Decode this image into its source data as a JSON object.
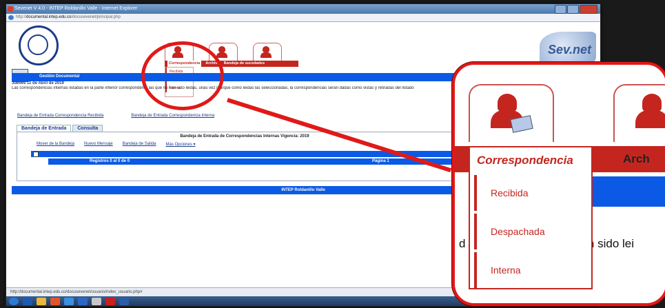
{
  "window": {
    "title": "Sevenet V 4.0 - INTEP Roldanillo Valle - Internet Explorer"
  },
  "address": {
    "prefix": "http://",
    "domain": "documental.intep.edu.co",
    "path": "/docusevenet/principal.php"
  },
  "nav": {
    "tabs": [
      "Correspondencia",
      "Archivo",
      "Bandeja de sucedades"
    ],
    "active_tab": "Correspondencia",
    "dropdown_items": [
      "Recibida",
      "Despachada",
      "Interna"
    ]
  },
  "module": {
    "title": "Gestión Documental"
  },
  "date": "Jueves 11 de Abril de 2019",
  "info_text": "Las correspondencias internas listadas en la parte inferior corresponden a las que no han sido leidas, unas vez marque como leidas las seleccionadas, la correspondencias serán dadas como vistas y retiradas del listado",
  "links": [
    "Bandeja de Entrada Correspondencia Recibida",
    "Bandeja de Entrada Correspondencia Interna"
  ],
  "tabs": [
    "Bandeja de Entrada",
    "Consulta"
  ],
  "panel": {
    "title": "Bandeja de Entrada de Correspondencias Internas Vigencia: 2019",
    "toolbar": [
      "Mover de la Bandeja",
      "Nuevo Mensaje",
      "Bandeja de Salida",
      "Más Opciones ▾"
    ],
    "records": "Registros 0 al 0 de 0",
    "page": "Página 1"
  },
  "footer": "INTEP Roldanillo Valle",
  "statusbar": "http://documental.intep.edu.co/docusevenet/usuario/index_usuario.php#",
  "zoom": {
    "tab_label": "Correspondencia",
    "next_tab": "Arch",
    "items": [
      "Recibida",
      "Despachada",
      "Interna"
    ],
    "body_left": "d",
    "body_right": "an sido lei"
  },
  "colors": {
    "brand_red": "#c4261f",
    "brand_blue": "#0a5ae6",
    "callout": "#e01919"
  }
}
